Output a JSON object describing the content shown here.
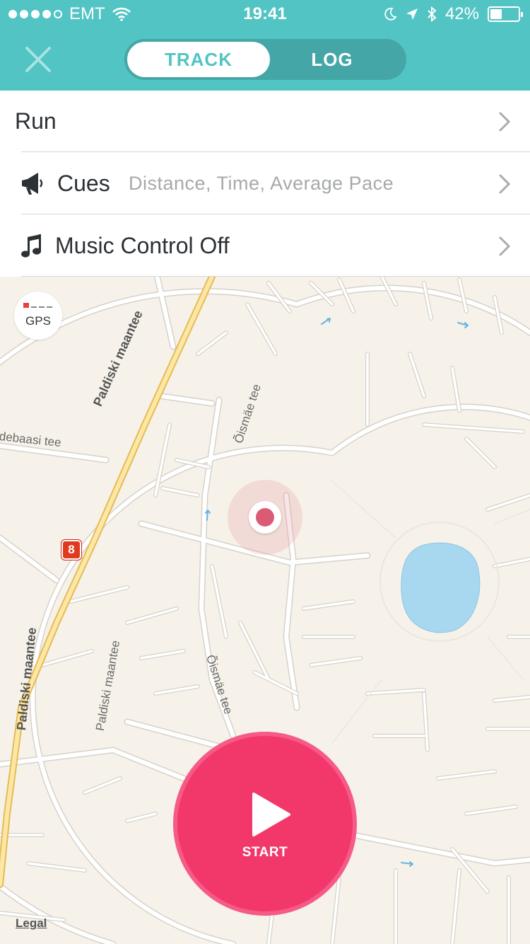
{
  "status_bar": {
    "carrier": "EMT",
    "time": "19:41",
    "battery": "42%",
    "battery_level": 0.42
  },
  "header": {
    "close_icon": "close-x-icon",
    "tabs": [
      {
        "label": "TRACK",
        "active": true
      },
      {
        "label": "LOG",
        "active": false
      }
    ]
  },
  "settings": {
    "activity": {
      "label": "Run"
    },
    "cues": {
      "icon": "megaphone-icon",
      "label": "Cues",
      "value": "Distance, Time, Average Pace"
    },
    "music": {
      "icon": "music-note-icon",
      "label": "Music Control Off"
    }
  },
  "map": {
    "gps_label": "GPS",
    "route_number": "8",
    "labels": {
      "paldiski_1": "Paldiski maantee",
      "paldiski_2": "Paldiski maantee",
      "paldiski_3": "Paldiski maantee",
      "oismae_1": "Õismäe tee",
      "oismae_2": "Õismäe tee",
      "sidestreet": "debaasi tee"
    },
    "legal": "Legal"
  },
  "start_button": {
    "label": "START"
  },
  "colors": {
    "header": "#52c4c4",
    "start": "#f2386b",
    "location": "#dc5b74",
    "water": "#a8d8f0"
  }
}
